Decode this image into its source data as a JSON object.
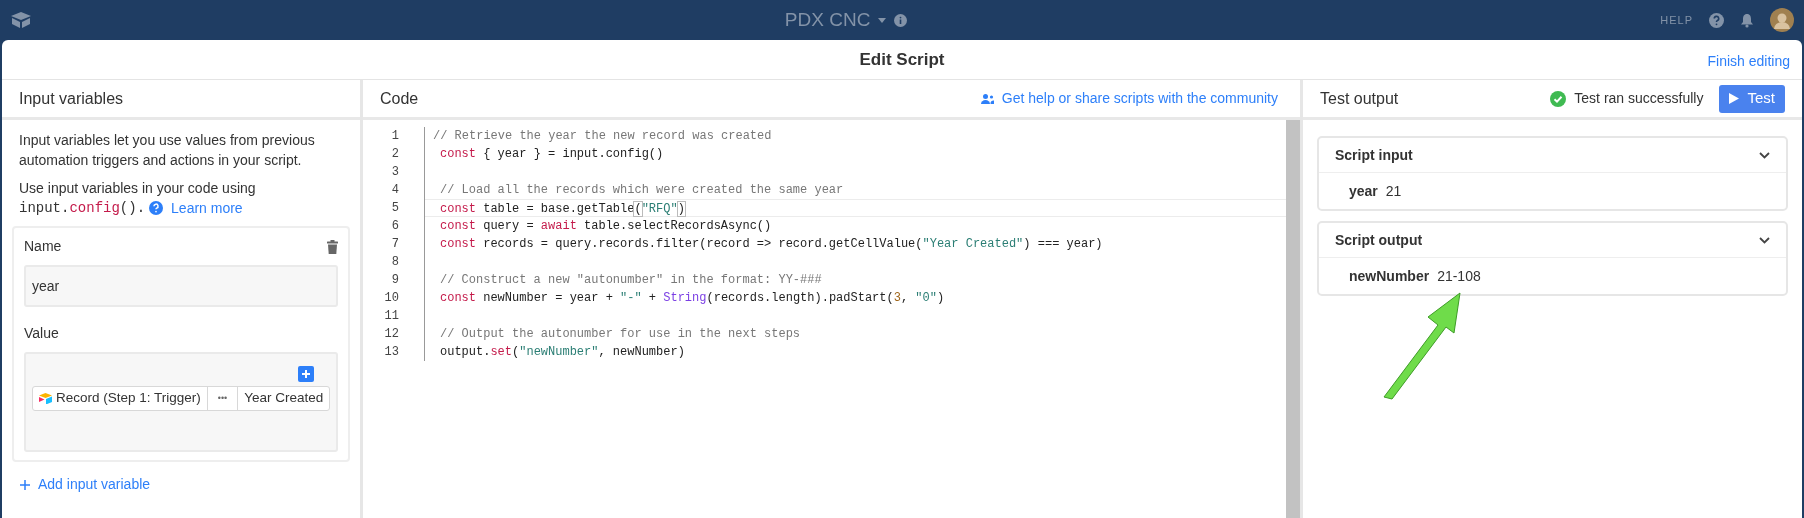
{
  "topbar": {
    "base_name": "PDX CNC",
    "help": "HELP"
  },
  "dialog": {
    "title": "Edit Script",
    "finish": "Finish editing"
  },
  "input_panel": {
    "title": "Input variables",
    "intro": "Input variables let you use values from previous automation triggers and actions in your script.",
    "usage": "Use input variables in your code using",
    "usage_code": [
      {
        "kind": "plain",
        "text": "input."
      },
      {
        "kind": "keyword",
        "text": "config"
      },
      {
        "kind": "plain",
        "text": "()."
      }
    ],
    "learn_more": "Learn more",
    "variables": [
      {
        "name_label": "Name",
        "name": "year",
        "value_label": "Value",
        "source": "Record (Step 1: Trigger)",
        "more": "•••",
        "field": "Year Created"
      }
    ],
    "add": "Add input variable"
  },
  "code_panel": {
    "title": "Code",
    "community": "Get help or share scripts with the community",
    "lines": [
      {
        "number": "1",
        "indent": false,
        "active": false,
        "tokens": [
          {
            "kind": "comment",
            "text": "// Retrieve the year the new record was created"
          }
        ]
      },
      {
        "number": "2",
        "indent": true,
        "active": false,
        "tokens": [
          {
            "kind": "keyword",
            "text": "const"
          },
          {
            "kind": "plain",
            "text": " { year } = input.config()"
          }
        ]
      },
      {
        "number": "3",
        "active": false
      },
      {
        "number": "4",
        "indent": true,
        "active": false,
        "tokens": [
          {
            "kind": "comment",
            "text": "// Load all the records which were created the same year"
          }
        ]
      },
      {
        "number": "5",
        "indent": true,
        "active": true,
        "tokens": [
          {
            "kind": "keyword",
            "text": "const"
          },
          {
            "kind": "plain",
            "text": " table = base.getTable"
          },
          {
            "kind": "bracket",
            "text": "("
          },
          {
            "kind": "string",
            "text": "\"RFQ\""
          },
          {
            "kind": "bracket",
            "text": ")"
          }
        ]
      },
      {
        "number": "6",
        "indent": true,
        "active": false,
        "tokens": [
          {
            "kind": "keyword",
            "text": "const"
          },
          {
            "kind": "plain",
            "text": " query = "
          },
          {
            "kind": "keyword",
            "text": "await"
          },
          {
            "kind": "plain",
            "text": " table.selectRecordsAsync()"
          }
        ]
      },
      {
        "number": "7",
        "indent": true,
        "active": false,
        "tokens": [
          {
            "kind": "keyword",
            "text": "const"
          },
          {
            "kind": "plain",
            "text": " records = query.records.filter(record => record.getCellValue("
          },
          {
            "kind": "string",
            "text": "\"Year Created\""
          },
          {
            "kind": "plain",
            "text": ") === year)"
          }
        ]
      },
      {
        "number": "8",
        "active": false
      },
      {
        "number": "9",
        "indent": true,
        "active": false,
        "tokens": [
          {
            "kind": "comment",
            "text": "// Construct a new \"autonumber\" in the format: YY-###"
          }
        ]
      },
      {
        "number": "10",
        "indent": true,
        "active": false,
        "tokens": [
          {
            "kind": "keyword",
            "text": "const"
          },
          {
            "kind": "plain",
            "text": " newNumber = year + "
          },
          {
            "kind": "string",
            "text": "\"-\""
          },
          {
            "kind": "plain",
            "text": " + "
          },
          {
            "kind": "builtin",
            "text": "String"
          },
          {
            "kind": "plain",
            "text": "(records.length).padStart("
          },
          {
            "kind": "number",
            "text": "3"
          },
          {
            "kind": "plain",
            "text": ", "
          },
          {
            "kind": "string",
            "text": "\"0\""
          },
          {
            "kind": "plain",
            "text": ")"
          }
        ]
      },
      {
        "number": "11",
        "active": false
      },
      {
        "number": "12",
        "indent": true,
        "active": false,
        "tokens": [
          {
            "kind": "comment",
            "text": "// Output the autonumber for use in the next steps"
          }
        ]
      },
      {
        "number": "13",
        "indent": true,
        "active": false,
        "tokens": [
          {
            "kind": "plain",
            "text": "output."
          },
          {
            "kind": "keyword",
            "text": "set"
          },
          {
            "kind": "plain",
            "text": "("
          },
          {
            "kind": "string",
            "text": "\"newNumber\""
          },
          {
            "kind": "plain",
            "text": ", newNumber)"
          }
        ]
      }
    ]
  },
  "test_panel": {
    "title": "Test output",
    "status": "Test ran successfully",
    "button": "Test",
    "sections": [
      {
        "title": "Script input",
        "expanded": true,
        "rows": [
          {
            "key": "year",
            "value": "21"
          }
        ]
      },
      {
        "title": "Script output",
        "expanded": true,
        "rows": [
          {
            "key": "newNumber",
            "value": "21-108"
          }
        ]
      }
    ]
  }
}
